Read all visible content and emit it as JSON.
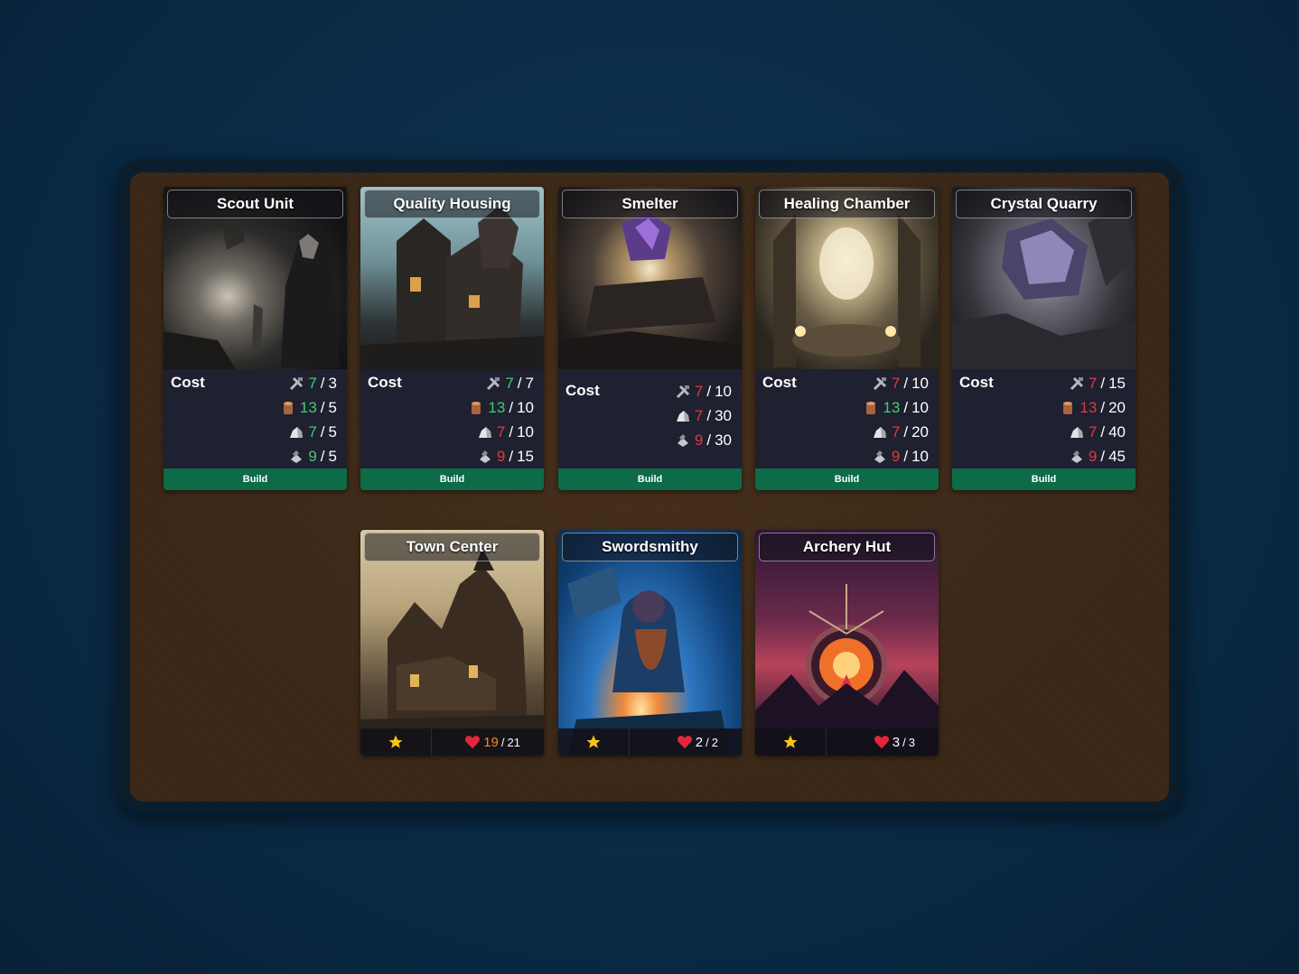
{
  "building_cards": [
    {
      "title": "Scout Unit",
      "cost_label": "Cost",
      "build_label": "Build",
      "costs": [
        {
          "icon": "tools-icon",
          "have": "7",
          "need": "3",
          "status": "ok"
        },
        {
          "icon": "wood-icon",
          "have": "13",
          "need": "5",
          "status": "ok"
        },
        {
          "icon": "stone-icon",
          "have": "7",
          "need": "5",
          "status": "ok"
        },
        {
          "icon": "metal-icon",
          "have": "9",
          "need": "5",
          "status": "ok"
        }
      ]
    },
    {
      "title": "Quality Housing",
      "cost_label": "Cost",
      "build_label": "Build",
      "costs": [
        {
          "icon": "tools-icon",
          "have": "7",
          "need": "7",
          "status": "ok"
        },
        {
          "icon": "wood-icon",
          "have": "13",
          "need": "10",
          "status": "ok"
        },
        {
          "icon": "stone-icon",
          "have": "7",
          "need": "10",
          "status": "bad"
        },
        {
          "icon": "metal-icon",
          "have": "9",
          "need": "15",
          "status": "bad"
        }
      ]
    },
    {
      "title": "Smelter",
      "cost_label": "Cost",
      "build_label": "Build",
      "costs": [
        {
          "icon": "tools-icon",
          "have": "7",
          "need": "10",
          "status": "bad"
        },
        {
          "icon": "stone-icon",
          "have": "7",
          "need": "30",
          "status": "bad"
        },
        {
          "icon": "metal-icon",
          "have": "9",
          "need": "30",
          "status": "bad"
        }
      ]
    },
    {
      "title": "Healing Chamber",
      "cost_label": "Cost",
      "build_label": "Build",
      "costs": [
        {
          "icon": "tools-icon",
          "have": "7",
          "need": "10",
          "status": "bad"
        },
        {
          "icon": "wood-icon",
          "have": "13",
          "need": "10",
          "status": "ok"
        },
        {
          "icon": "stone-icon",
          "have": "7",
          "need": "20",
          "status": "bad"
        },
        {
          "icon": "metal-icon",
          "have": "9",
          "need": "10",
          "status": "bad"
        }
      ]
    },
    {
      "title": "Crystal Quarry",
      "cost_label": "Cost",
      "build_label": "Build",
      "costs": [
        {
          "icon": "tools-icon",
          "have": "7",
          "need": "15",
          "status": "bad"
        },
        {
          "icon": "wood-icon",
          "have": "13",
          "need": "20",
          "status": "bad"
        },
        {
          "icon": "stone-icon",
          "have": "7",
          "need": "40",
          "status": "bad"
        },
        {
          "icon": "metal-icon",
          "have": "9",
          "need": "45",
          "status": "bad"
        }
      ]
    }
  ],
  "unit_cards": [
    {
      "title": "Town Center",
      "hp_current": "19",
      "hp_max": "21",
      "hurt": true
    },
    {
      "title": "Swordsmithy",
      "hp_current": "2",
      "hp_max": "2",
      "hurt": false
    },
    {
      "title": "Archery Hut",
      "hp_current": "3",
      "hp_max": "3",
      "hurt": false
    }
  ],
  "hp_separator": "/",
  "cost_separator": "/",
  "colors": {
    "ok": "#3ecf6e",
    "bad": "#e03a3a",
    "build_button": "#0d6b47",
    "star": "#f5c518",
    "heart": "#e3263a"
  }
}
